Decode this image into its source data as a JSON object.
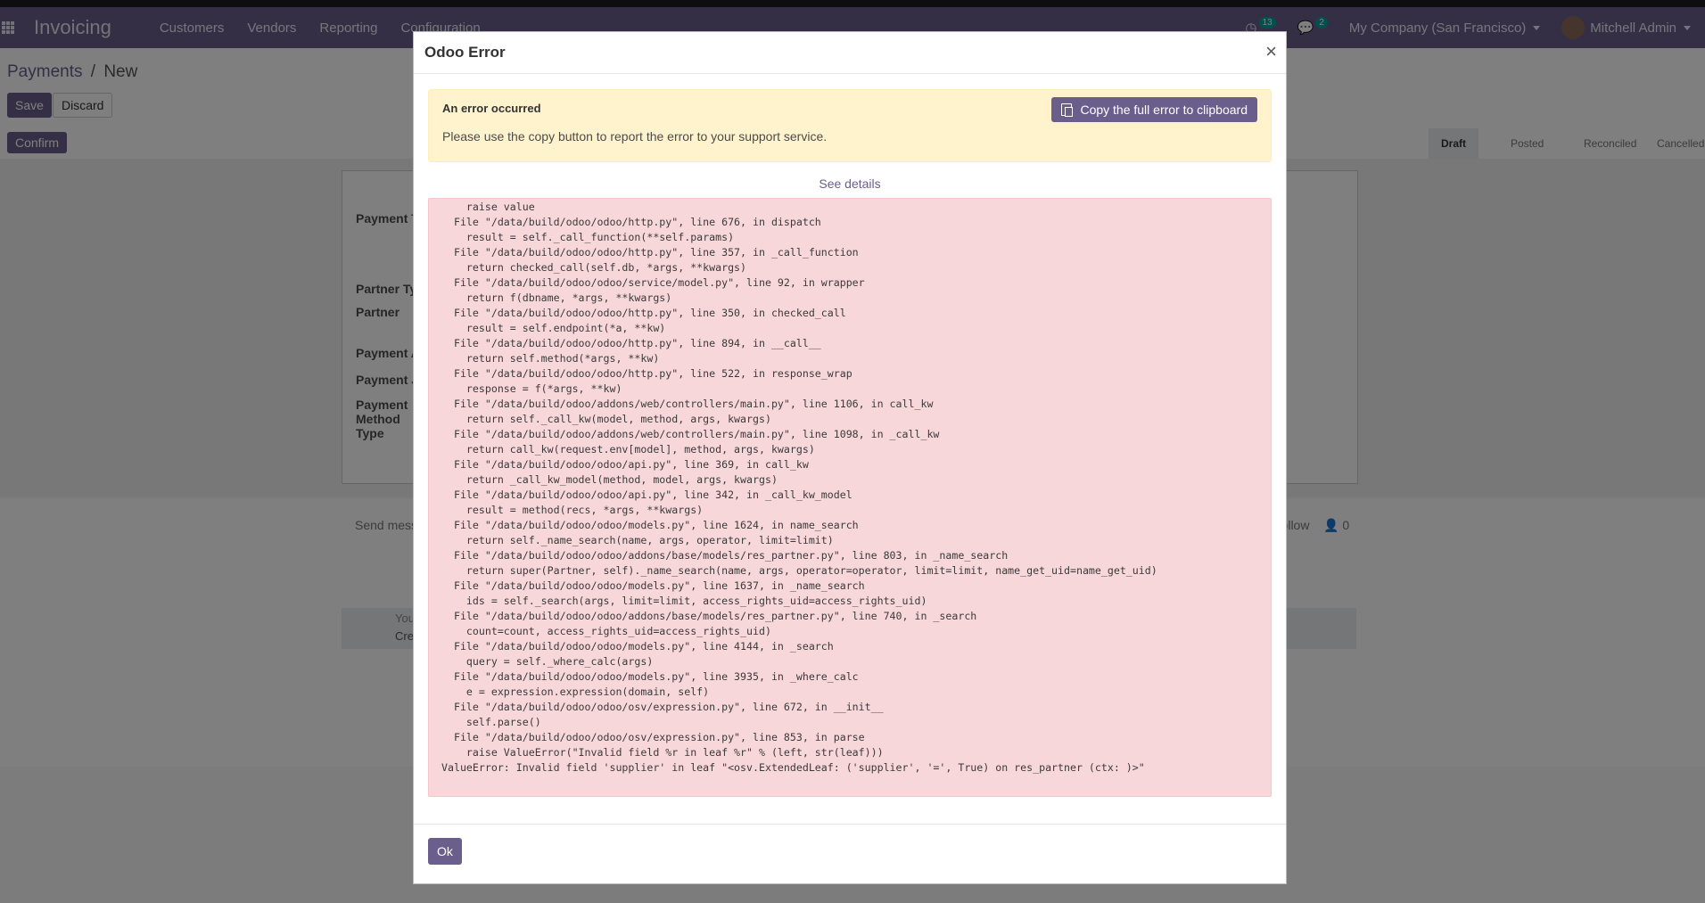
{
  "app": {
    "name": "Invoicing",
    "menu": [
      "Customers",
      "Vendors",
      "Reporting",
      "Configuration"
    ],
    "activity_count": "13",
    "messages_count": "2",
    "company": "My Company (San Francisco)",
    "user": "Mitchell Admin"
  },
  "page": {
    "breadcrumb_parent": "Payments",
    "breadcrumb_sep": "/",
    "breadcrumb_current": "New",
    "save_label": "Save",
    "discard_label": "Discard",
    "confirm_label": "Confirm",
    "stages": [
      "Draft",
      "Posted",
      "Reconciled",
      "Cancelled"
    ],
    "active_stage": "Draft",
    "field_labels": [
      "Payment Type",
      "Partner Type",
      "Partner",
      "Payment Amount",
      "Payment Journal",
      "Payment Method Type"
    ],
    "send_message": "Send message",
    "follow": "Follow",
    "followers_count": "0",
    "activity_hint": "You",
    "create_hint": "Create"
  },
  "dialog": {
    "title": "Odoo Error",
    "close_symbol": "×",
    "alert_title": "An error occurred",
    "alert_text": "Please use the copy button to report the error to your support service.",
    "copy_label": "Copy the full error to clipboard",
    "see_details": "See details",
    "traceback": [
      "  raise value",
      "File \"/data/build/odoo/odoo/http.py\", line 676, in dispatch",
      "  result = self._call_function(**self.params)",
      "File \"/data/build/odoo/odoo/http.py\", line 357, in _call_function",
      "  return checked_call(self.db, *args, **kwargs)",
      "File \"/data/build/odoo/odoo/service/model.py\", line 92, in wrapper",
      "  return f(dbname, *args, **kwargs)",
      "File \"/data/build/odoo/odoo/http.py\", line 350, in checked_call",
      "  result = self.endpoint(*a, **kw)",
      "File \"/data/build/odoo/odoo/http.py\", line 894, in __call__",
      "  return self.method(*args, **kw)",
      "File \"/data/build/odoo/odoo/http.py\", line 522, in response_wrap",
      "  response = f(*args, **kw)",
      "File \"/data/build/odoo/addons/web/controllers/main.py\", line 1106, in call_kw",
      "  return self._call_kw(model, method, args, kwargs)",
      "File \"/data/build/odoo/addons/web/controllers/main.py\", line 1098, in _call_kw",
      "  return call_kw(request.env[model], method, args, kwargs)",
      "File \"/data/build/odoo/odoo/api.py\", line 369, in call_kw",
      "  return _call_kw_model(method, model, args, kwargs)",
      "File \"/data/build/odoo/odoo/api.py\", line 342, in _call_kw_model",
      "  result = method(recs, *args, **kwargs)",
      "File \"/data/build/odoo/odoo/models.py\", line 1624, in name_search",
      "  return self._name_search(name, args, operator, limit=limit)",
      "File \"/data/build/odoo/odoo/addons/base/models/res_partner.py\", line 803, in _name_search",
      "  return super(Partner, self)._name_search(name, args, operator=operator, limit=limit, name_get_uid=name_get_uid)",
      "File \"/data/build/odoo/odoo/models.py\", line 1637, in _name_search",
      "  ids = self._search(args, limit=limit, access_rights_uid=access_rights_uid)",
      "File \"/data/build/odoo/odoo/addons/base/models/res_partner.py\", line 740, in _search",
      "  count=count, access_rights_uid=access_rights_uid)",
      "File \"/data/build/odoo/odoo/models.py\", line 4144, in _search",
      "  query = self._where_calc(args)",
      "File \"/data/build/odoo/odoo/models.py\", line 3935, in _where_calc",
      "  e = expression.expression(domain, self)",
      "File \"/data/build/odoo/odoo/osv/expression.py\", line 672, in __init__",
      "  self.parse()",
      "File \"/data/build/odoo/odoo/osv/expression.py\", line 853, in parse",
      "  raise ValueError(\"Invalid field %r in leaf %r\" % (left, str(leaf)))"
    ],
    "error_line": "ValueError: Invalid field 'supplier' in leaf \"<osv.ExtendedLeaf: ('supplier', '=', True) on res_partner (ctx: )>\"",
    "ok_label": "Ok"
  },
  "colors": {
    "brand": "#6a5e8c",
    "alert_bg": "#fff3cd",
    "trace_bg": "#f8d7da"
  }
}
